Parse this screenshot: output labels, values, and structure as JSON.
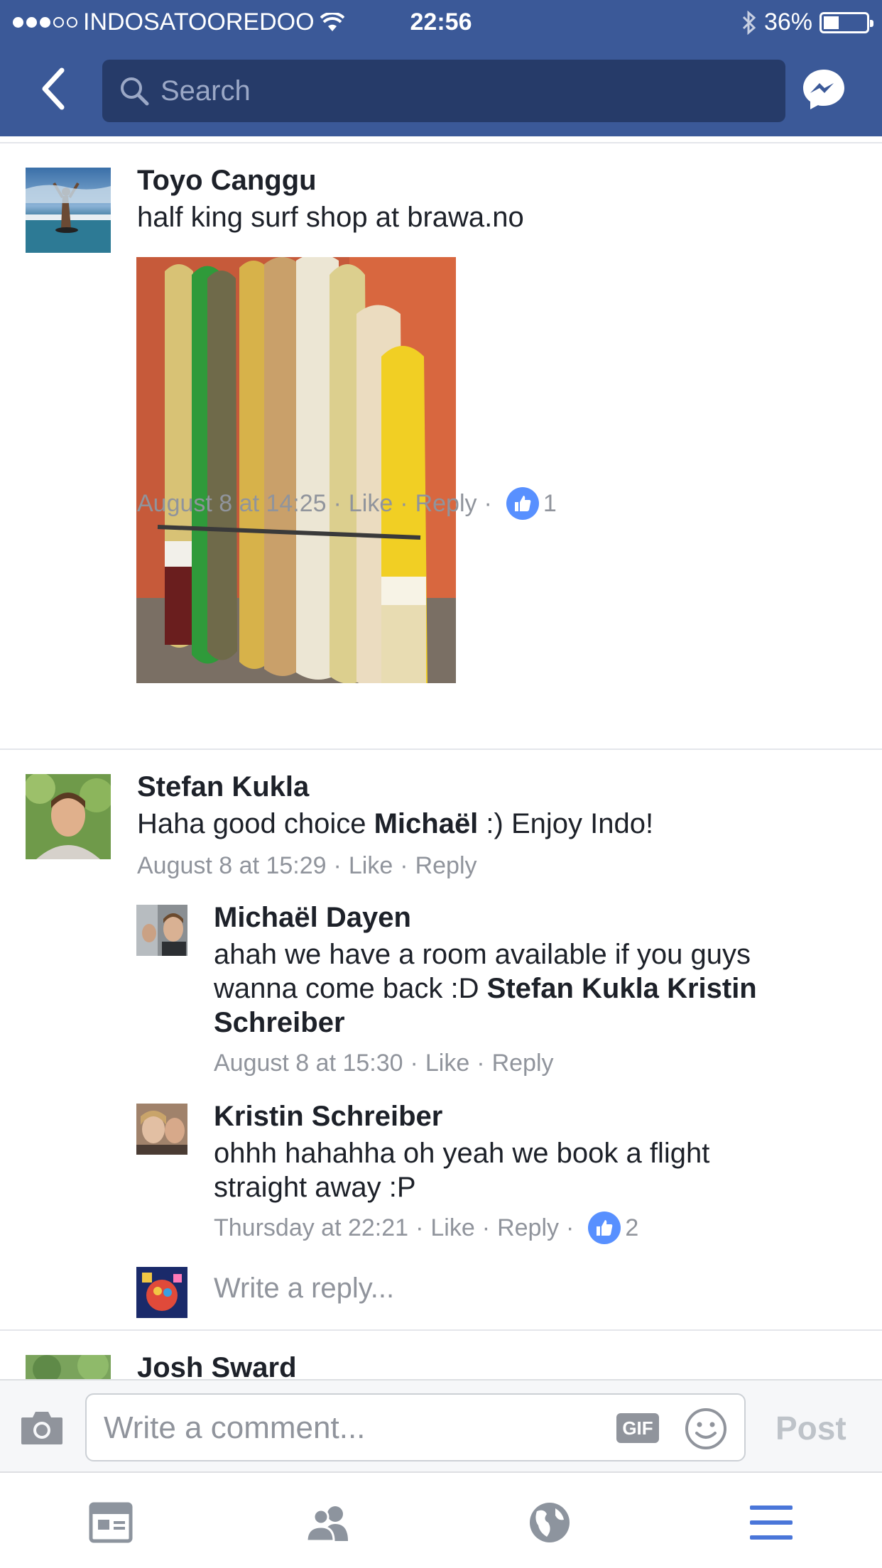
{
  "status_bar": {
    "carrier": "INDOSATOOREDOO",
    "time": "22:56",
    "battery": "36%",
    "battery_level": 0.36
  },
  "header": {
    "search_placeholder": "Search"
  },
  "comments": [
    {
      "name": "Toyo Canggu",
      "text": "half king surf shop at brawa.no",
      "time": "August 8 at 14:25",
      "like": "Like",
      "reply": "Reply",
      "reactions": "1"
    },
    {
      "name": "Stefan Kukla",
      "text_before": "Haha good choice ",
      "mention": "Michaël",
      "text_after": " :) Enjoy Indo!",
      "time": "August 8 at 15:29",
      "like": "Like",
      "reply": "Reply"
    }
  ],
  "replies": [
    {
      "name": "Michaël Dayen",
      "text_line1": "ahah we have a room available if you guys",
      "text_line2_plain": "wanna come back :D ",
      "mention1": "Stefan Kukla",
      "mention2_part1": "Kristin",
      "mention2_part2": "Schreiber",
      "time": "August 8 at 15:30",
      "like": "Like",
      "reply": "Reply"
    },
    {
      "name": "Kristin Schreiber",
      "text_line1": "ohhh hahahha oh yeah we book a flight",
      "text_line2": "straight away :P",
      "time": "Thursday at 22:21",
      "like": "Like",
      "reply": "Reply",
      "reactions": "2"
    }
  ],
  "write_reply_placeholder": "Write a reply...",
  "next_comment_name": "Josh Sward",
  "composer": {
    "placeholder": "Write a comment...",
    "gif_label": "GIF",
    "post_label": "Post"
  },
  "colors": {
    "brand": "#3b5998",
    "like_blue": "#5890ff",
    "tab_active": "#4a76d9",
    "tab_inactive": "#8d949e"
  }
}
